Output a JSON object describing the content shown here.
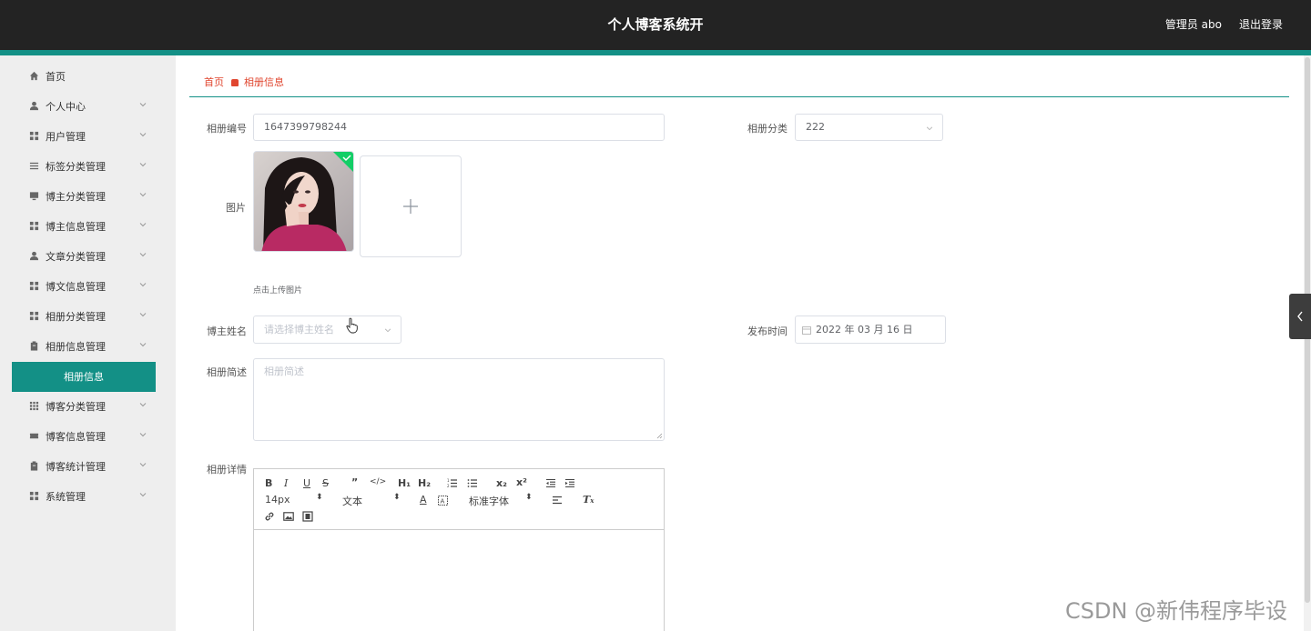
{
  "header": {
    "title": "个人博客系统开",
    "user": "管理员 abo",
    "logout": "退出登录"
  },
  "colors": {
    "accent": "#139086",
    "breadcrumb": "#e0462f",
    "topbar": "#232323"
  },
  "sidebar": {
    "items": [
      {
        "label": "首页",
        "icon": "home-icon"
      },
      {
        "label": "个人中心",
        "icon": "user-icon"
      },
      {
        "label": "用户管理",
        "icon": "grid-icon"
      },
      {
        "label": "标签分类管理",
        "icon": "list-icon"
      },
      {
        "label": "博主分类管理",
        "icon": "monitor-icon"
      },
      {
        "label": "博主信息管理",
        "icon": "grid-icon"
      },
      {
        "label": "文章分类管理",
        "icon": "user-icon"
      },
      {
        "label": "博文信息管理",
        "icon": "grid-icon"
      },
      {
        "label": "相册分类管理",
        "icon": "grid-icon"
      },
      {
        "label": "相册信息管理",
        "icon": "clipboard-icon"
      },
      {
        "label": "博客分类管理",
        "icon": "apps-icon"
      },
      {
        "label": "博客信息管理",
        "icon": "ticket-icon"
      },
      {
        "label": "博客统计管理",
        "icon": "clipboard-icon"
      },
      {
        "label": "系统管理",
        "icon": "grid-icon"
      }
    ],
    "active_sub": "相册信息"
  },
  "breadcrumb": {
    "home": "首页",
    "current": "相册信息"
  },
  "form": {
    "album_no": {
      "label": "相册编号",
      "value": "1647399798244"
    },
    "album_category": {
      "label": "相册分类",
      "value": "222"
    },
    "image": {
      "label": "图片",
      "tip": "点击上传图片"
    },
    "blogger_name": {
      "label": "博主姓名",
      "placeholder": "请选择博主姓名"
    },
    "publish_time": {
      "label": "发布时间",
      "value": "2022 年 03 月 16 日"
    },
    "description": {
      "label": "相册简述",
      "placeholder": "相册简述"
    },
    "details": {
      "label": "相册详情"
    }
  },
  "editor_toolbar": {
    "font_size": "14px",
    "header_select": "文本",
    "font_family": "标准字体"
  },
  "watermark": "CSDN @新伟程序毕设"
}
